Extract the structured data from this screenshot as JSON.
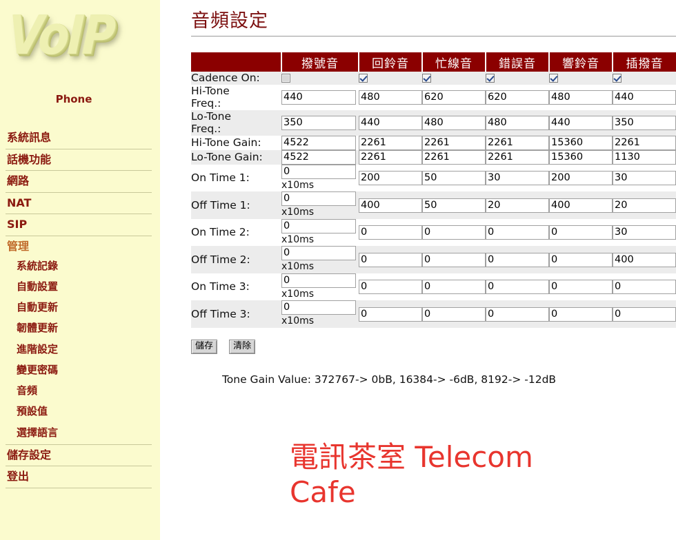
{
  "sidebar": {
    "logo_text": "VoIP",
    "phone_label": "Phone",
    "items": [
      {
        "label": "系統訊息",
        "type": "top"
      },
      {
        "label": "話機功能",
        "type": "top"
      },
      {
        "label": "網路",
        "type": "top"
      },
      {
        "label": "NAT",
        "type": "top"
      },
      {
        "label": "SIP",
        "type": "top"
      },
      {
        "label": "管理",
        "type": "section"
      },
      {
        "label": "系統記錄",
        "type": "sub"
      },
      {
        "label": "自動設置",
        "type": "sub"
      },
      {
        "label": "自動更新",
        "type": "sub"
      },
      {
        "label": "韌體更新",
        "type": "sub"
      },
      {
        "label": "進階設定",
        "type": "sub"
      },
      {
        "label": "變更密碼",
        "type": "sub"
      },
      {
        "label": "音頻",
        "type": "sub"
      },
      {
        "label": "預設值",
        "type": "sub"
      },
      {
        "label": "選擇語言",
        "type": "sub"
      },
      {
        "label": "儲存設定",
        "type": "top-rule"
      },
      {
        "label": "登出",
        "type": "top"
      }
    ]
  },
  "main": {
    "title": "音頻設定",
    "columns": [
      "撥號音",
      "回鈴音",
      "忙線音",
      "錯誤音",
      "響鈴音",
      "插撥音"
    ],
    "units_label": "x10ms",
    "rows": [
      {
        "label": "Cadence On:",
        "kind": "checkbox",
        "values": [
          false,
          true,
          true,
          true,
          true,
          true
        ]
      },
      {
        "label": "Hi-Tone\nFreq.:",
        "kind": "input",
        "values": [
          "440",
          "480",
          "620",
          "620",
          "480",
          "440"
        ]
      },
      {
        "label": "Lo-Tone\nFreq.:",
        "kind": "input",
        "values": [
          "350",
          "440",
          "480",
          "480",
          "440",
          "350"
        ]
      },
      {
        "label": "Hi-Tone Gain:",
        "kind": "input",
        "values": [
          "4522",
          "2261",
          "2261",
          "2261",
          "15360",
          "2261"
        ]
      },
      {
        "label": "Lo-Tone Gain:",
        "kind": "input",
        "values": [
          "4522",
          "2261",
          "2261",
          "2261",
          "15360",
          "1130"
        ]
      },
      {
        "label": "On Time 1:",
        "kind": "input-units",
        "values": [
          "0",
          "200",
          "50",
          "30",
          "200",
          "30"
        ]
      },
      {
        "label": "Off Time 1:",
        "kind": "input-units",
        "values": [
          "0",
          "400",
          "50",
          "20",
          "400",
          "20"
        ]
      },
      {
        "label": "On Time 2:",
        "kind": "input-units",
        "values": [
          "0",
          "0",
          "0",
          "0",
          "0",
          "30"
        ]
      },
      {
        "label": "Off Time 2:",
        "kind": "input-units",
        "values": [
          "0",
          "0",
          "0",
          "0",
          "0",
          "400"
        ]
      },
      {
        "label": "On Time 3:",
        "kind": "input-units",
        "values": [
          "0",
          "0",
          "0",
          "0",
          "0",
          "0"
        ]
      },
      {
        "label": "Off Time 3:",
        "kind": "input-units",
        "values": [
          "0",
          "0",
          "0",
          "0",
          "0",
          "0"
        ]
      }
    ],
    "save_label": "儲存",
    "clear_label": "清除",
    "gain_note": "Tone Gain Value: 372767-> 0bB, 16384-> -6dB, 8192-> -12dB"
  },
  "watermark": {
    "line1": "電訊茶室 Telecom",
    "line2": "Cafe"
  },
  "colors": {
    "sidebar_bg": "#fbfbce",
    "menu_text": "#8b1a10",
    "section_text": "#c06a2a",
    "table_header_bg": "#8b0000",
    "title_text": "#7c1010",
    "watermark": "#e8352e",
    "row_shade": "#ececec"
  }
}
